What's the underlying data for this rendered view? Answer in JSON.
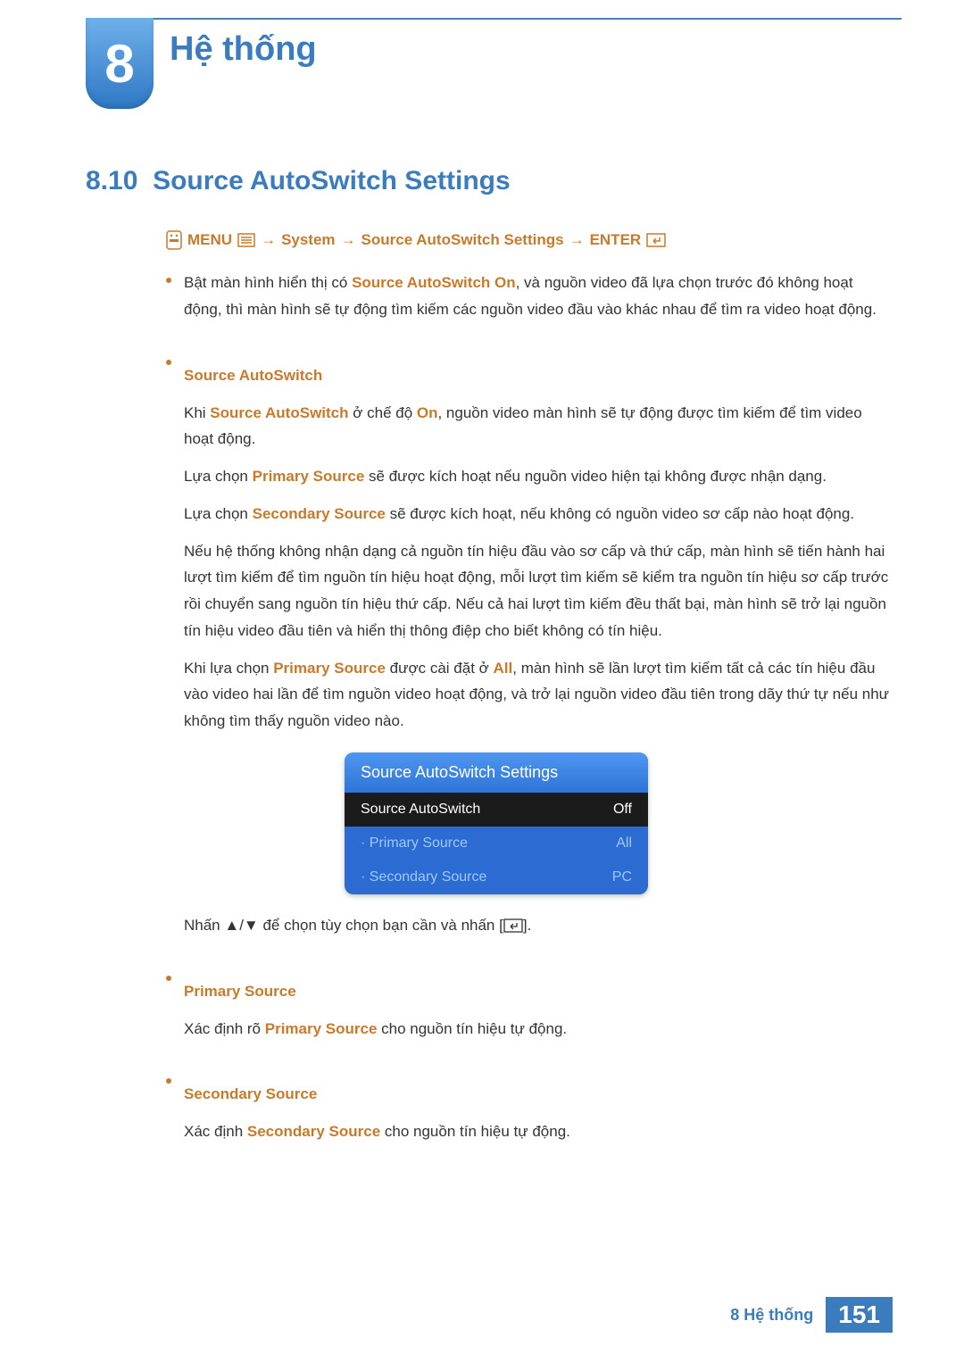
{
  "chapter": {
    "number": "8",
    "title": "Hệ thống"
  },
  "section": {
    "number": "8.10",
    "title": "Source AutoSwitch Settings"
  },
  "nav": {
    "menu": "MENU",
    "arrow": "→",
    "system": "System",
    "sas": "Source AutoSwitch Settings",
    "enter": "ENTER"
  },
  "intro": {
    "pre": "Bật màn hình hiển thị có ",
    "hl": "Source AutoSwitch On",
    "post": ", và nguồn video đã lựa chọn trước đó không hoạt động, thì màn hình sẽ tự động tìm kiếm các nguồn video đầu vào khác nhau để tìm ra video hoạt động."
  },
  "sas_block": {
    "heading": "Source AutoSwitch",
    "p1_a": "Khi ",
    "p1_hl1": "Source AutoSwitch",
    "p1_b": " ở chế độ ",
    "p1_hl2": "On",
    "p1_c": ", nguồn video màn hình sẽ tự động được tìm kiếm để tìm video hoạt động.",
    "p2_a": "Lựa chọn ",
    "p2_hl": "Primary Source",
    "p2_b": " sẽ được kích hoạt nếu nguồn video hiện tại không được nhận dạng.",
    "p3_a": "Lựa chọn ",
    "p3_hl": "Secondary Source",
    "p3_b": " sẽ được kích hoạt, nếu không có nguồn video sơ cấp nào hoạt động.",
    "p4": "Nếu hệ thống không nhận dạng cả nguồn tín hiệu đầu vào sơ cấp và thứ cấp, màn hình sẽ tiến hành hai lượt tìm kiếm để tìm nguồn tín hiệu hoạt động, mỗi lượt tìm kiếm sẽ kiểm tra nguồn tín hiệu sơ cấp trước rồi chuyển sang nguồn tín hiệu thứ cấp. Nếu cả hai lượt tìm kiếm đều thất bại, màn hình sẽ trở lại nguồn tín hiệu video đầu tiên và hiển thị thông điệp cho biết không có tín hiệu.",
    "p5_a": "Khi lựa chọn ",
    "p5_hl1": "Primary Source",
    "p5_b": " được cài đặt ở ",
    "p5_hl2": "All",
    "p5_c": ", màn hình sẽ lần lượt tìm kiếm tất cả các tín hiệu đầu vào video hai lần để tìm nguồn video hoạt động, và trở lại nguồn video đầu tiên trong dãy thứ tự nếu như không tìm thấy nguồn video nào."
  },
  "osd": {
    "title": "Source AutoSwitch Settings",
    "rows": [
      {
        "label": "Source AutoSwitch",
        "value": "Off",
        "state": "selected"
      },
      {
        "label": "· Primary Source",
        "value": "All",
        "state": "dim"
      },
      {
        "label": "· Secondary Source",
        "value": "PC",
        "state": "dim"
      }
    ]
  },
  "hint": {
    "a": "Nhấn ▲/▼ để chọn tùy chọn bạn cần và nhấn [",
    "b": "]."
  },
  "primary": {
    "heading": "Primary Source",
    "a": "Xác định rõ ",
    "hl": "Primary Source",
    "b": " cho nguồn tín hiệu tự động."
  },
  "secondary": {
    "heading": "Secondary Source",
    "a": "Xác định ",
    "hl": "Secondary Source",
    "b": " cho nguồn tín hiệu tự động."
  },
  "footer": {
    "label": "8 Hệ thống",
    "page": "151"
  }
}
